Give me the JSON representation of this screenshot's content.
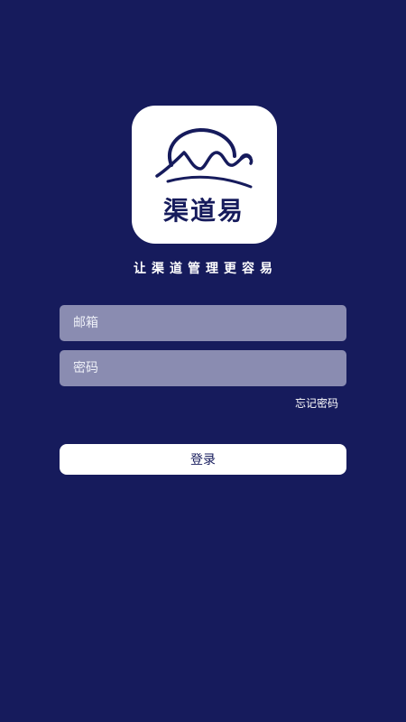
{
  "app": {
    "logo_text": "渠道易",
    "slogan": "让渠道管理更容易"
  },
  "form": {
    "email_placeholder": "邮箱",
    "email_value": "",
    "password_placeholder": "密码",
    "password_value": "",
    "forgot_password_label": "忘记密码",
    "login_label": "登录"
  },
  "colors": {
    "background": "#161b5c",
    "field_fill": "#8a8cb1",
    "button_fill": "#ffffff",
    "brand_navy": "#161b5c"
  },
  "icons": {
    "logo": "camel-mountain-sun-logo-icon"
  }
}
